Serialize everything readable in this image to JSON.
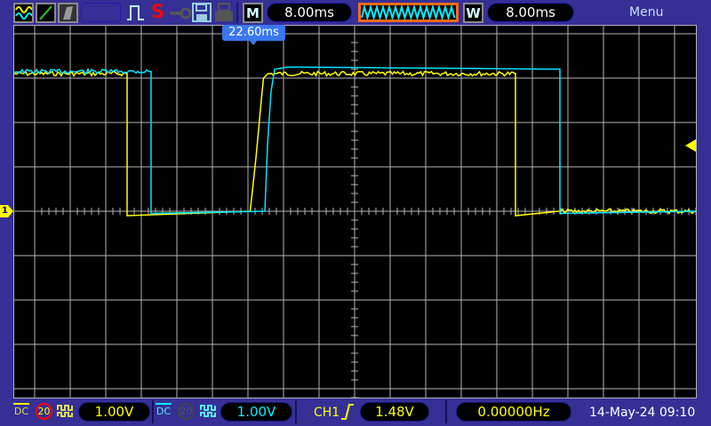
{
  "toolbar": {
    "icons": [
      "dual-wave-icon",
      "line-icon",
      "persistence-icon",
      "pulse-icon",
      "save-icon-s",
      "key-icon",
      "floppy-icon",
      "printer-icon"
    ],
    "s_label": "S",
    "mode_badge": "M",
    "main_timebase": "8.00ms",
    "window_badge": "W",
    "window_timebase": "8.00ms",
    "menu_label": "Menu"
  },
  "display": {
    "trigger_position_label": "22.60ms",
    "channel_marker": "1",
    "colors": {
      "ch1": "#ffff00",
      "ch2": "#00e5ff",
      "grid": "#b4b4b4",
      "background": "#000000",
      "ui": "#352f96"
    }
  },
  "waveforms": {
    "time_per_div_ms": 8,
    "volts_per_div": 1.0,
    "trigger_level_v": 1.48,
    "ch1": {
      "points_ms_v": [
        [
          -76.8,
          3.1
        ],
        [
          -51.2,
          3.1
        ],
        [
          -51.2,
          -0.1
        ],
        [
          -23.5,
          0.0
        ],
        [
          -22.2,
          1.2
        ],
        [
          -21.0,
          2.5
        ],
        [
          -20.5,
          3.0
        ],
        [
          -19.5,
          3.1
        ],
        [
          36.2,
          3.1
        ],
        [
          36.2,
          -0.1
        ],
        [
          46,
          0.0
        ],
        [
          76.8,
          0.0
        ]
      ]
    },
    "ch2": {
      "points_ms_v": [
        [
          -76.8,
          3.15
        ],
        [
          -45.8,
          3.15
        ],
        [
          -45.8,
          -0.05
        ],
        [
          -20.2,
          0.0
        ],
        [
          -19.6,
          1.5
        ],
        [
          -18.8,
          2.7
        ],
        [
          -18.0,
          3.2
        ],
        [
          -15,
          3.25
        ],
        [
          46.2,
          3.2
        ],
        [
          46.2,
          -0.05
        ],
        [
          76.8,
          0.0
        ]
      ]
    }
  },
  "status": {
    "ch1": {
      "coupling": "DC",
      "bw_limit": "20",
      "volts": "1.00V"
    },
    "ch2": {
      "coupling": "DC",
      "bw_limit": "20",
      "volts": "1.00V"
    },
    "trigger": {
      "source": "CH1",
      "slope": "rising",
      "level": "1.48V"
    },
    "frequency": "0.00000Hz",
    "datetime": "14-May-24 09:10"
  }
}
